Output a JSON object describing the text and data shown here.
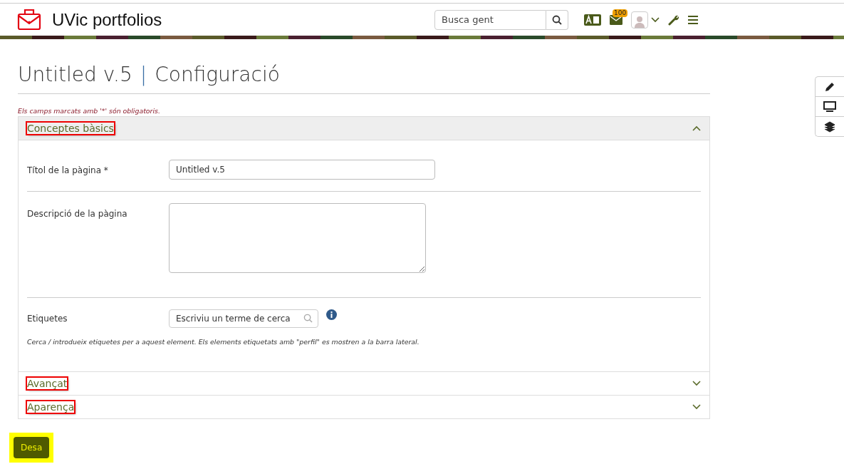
{
  "header": {
    "logo_text": "UVic portfolios",
    "search": {
      "placeholder": "Busca gent"
    },
    "notification_count": "100"
  },
  "page": {
    "title": "Untitled v.5",
    "separator": "|",
    "subtitle": "Configuració"
  },
  "required_note": "Els camps marcats amb '*' són obligatoris.",
  "sections": [
    {
      "title": "Conceptes bàsics",
      "expanded": true,
      "annotated": true,
      "fields": [
        {
          "kind": "text",
          "label": "Títol de la pàgina *",
          "value": "Untitled v.5"
        },
        {
          "kind": "textarea",
          "label": "Descripció de la pàgina"
        },
        {
          "kind": "tags",
          "label": "Etiquetes",
          "placeholder": "Escriviu un terme de cerca",
          "help": "Cerca / introdueix etiquetes per a aquest element. Els elements etiquetats amb \"perfil\" es mostren a la barra lateral."
        }
      ]
    },
    {
      "title": "Avançat",
      "expanded": false,
      "annotated": true
    },
    {
      "title": "Aparença",
      "expanded": false,
      "annotated": true
    }
  ],
  "save_button": {
    "label": "Desa",
    "highlighted": true
  }
}
